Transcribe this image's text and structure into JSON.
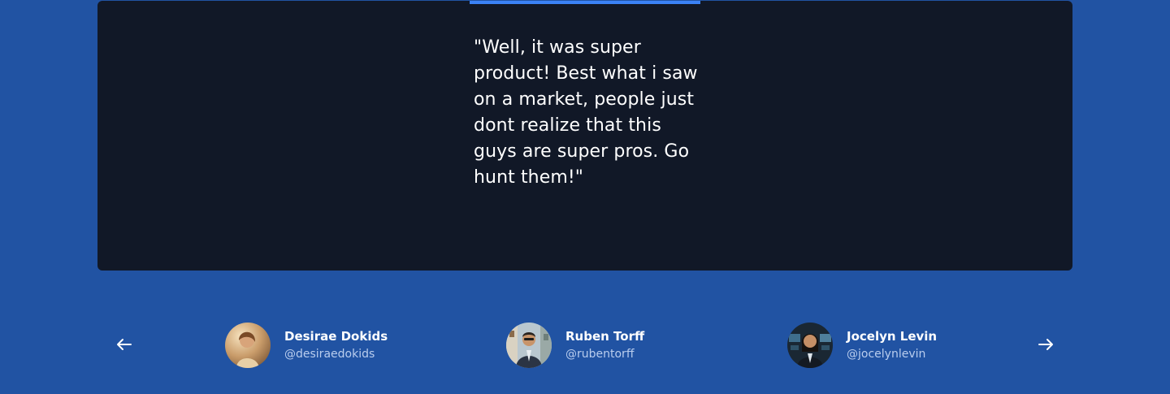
{
  "testimonial": {
    "quote": "\"Well, it was super product! Best what i saw on a market, people just dont realize that this guys are super pros. Go hunt them!\"",
    "accent_color": "#3b82f6",
    "card_color": "#111827"
  },
  "page": {
    "background_color": "#2153a3"
  },
  "navigation": {
    "prev_icon": "arrow-left-icon",
    "next_icon": "arrow-right-icon"
  },
  "authors": [
    {
      "name": "Desirae Dokids",
      "handle": "@desiraedokids"
    },
    {
      "name": "Ruben Torff",
      "handle": "@rubentorff"
    },
    {
      "name": "Jocelyn Levin",
      "handle": "@jocelynlevin"
    }
  ]
}
